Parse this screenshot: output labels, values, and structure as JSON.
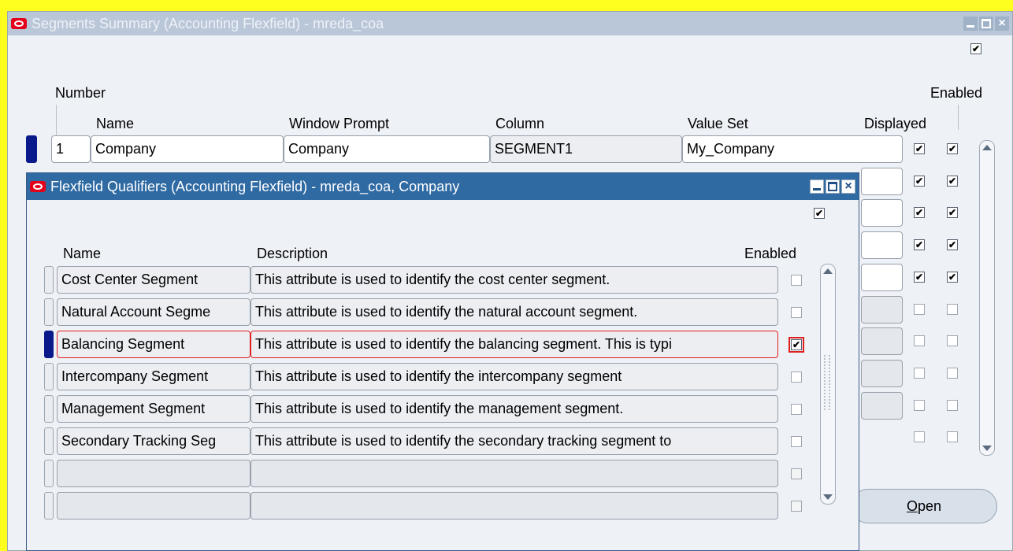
{
  "colors": {
    "background": "#ffff1e",
    "inactive_title": "#b9c7d8",
    "active_title": "#2f6aa3",
    "current_record": "#0b1a8a",
    "focus_outline": "#e01f1f"
  },
  "segments_window": {
    "title": "Segments Summary (Accounting Flexfield) - mreda_coa",
    "top_checkbox": true,
    "headers": {
      "number": "Number",
      "name": "Name",
      "window_prompt": "Window Prompt",
      "column": "Column",
      "value_set": "Value Set",
      "enabled": "Enabled",
      "displayed": "Displayed"
    },
    "row1": {
      "number": "1",
      "name": "Company",
      "window_prompt": "Company",
      "column": "SEGMENT1",
      "value_set": "My_Company"
    },
    "rows": [
      {
        "displayed": true,
        "enabled": true
      },
      {
        "displayed": true,
        "enabled": true
      },
      {
        "displayed": true,
        "enabled": true
      },
      {
        "displayed": true,
        "enabled": true
      },
      {
        "displayed": true,
        "enabled": true
      },
      {
        "displayed": false,
        "enabled": false
      },
      {
        "displayed": false,
        "enabled": false
      },
      {
        "displayed": false,
        "enabled": false
      },
      {
        "displayed": false,
        "enabled": false
      },
      {
        "displayed": false,
        "enabled": false
      }
    ],
    "open_button_label": "Open",
    "open_button_mnemonic": "O"
  },
  "qualifiers_window": {
    "title": "Flexfield Qualifiers (Accounting Flexfield) - mreda_coa, Company",
    "top_checkbox": true,
    "headers": {
      "name": "Name",
      "description": "Description",
      "enabled": "Enabled"
    },
    "rows": [
      {
        "name": "Cost Center Segment",
        "description": "This attribute is used to identify the cost center segment.",
        "enabled": false
      },
      {
        "name": "Natural Account Segme",
        "description": "This attribute is used to identify the natural account segment.",
        "enabled": false
      },
      {
        "name": "Balancing Segment",
        "description": "This attribute is used to identify the balancing segment. This is typi",
        "enabled": true,
        "current": true
      },
      {
        "name": "Intercompany Segment",
        "description": "This attribute is used to identify the intercompany segment",
        "enabled": false
      },
      {
        "name": "Management Segment",
        "description": "This attribute is used to identify the management segment.",
        "enabled": false
      },
      {
        "name": "Secondary Tracking Seg",
        "description": "This attribute is used to identify the secondary tracking segment to",
        "enabled": false
      },
      {
        "name": "",
        "description": "",
        "enabled": false,
        "blank": true
      },
      {
        "name": "",
        "description": "",
        "enabled": false,
        "blank": true
      }
    ]
  }
}
